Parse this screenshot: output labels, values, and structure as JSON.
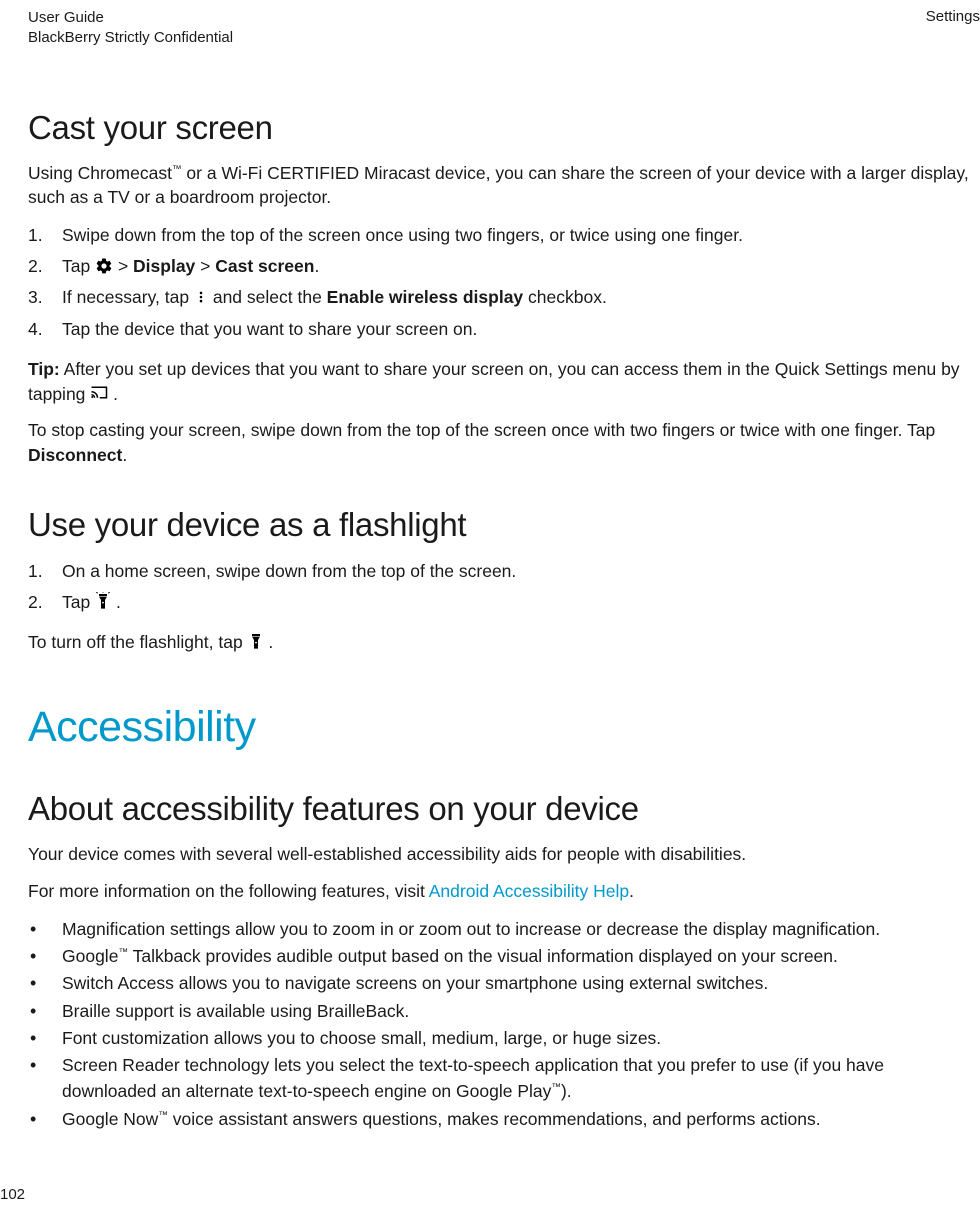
{
  "header": {
    "line1": "User Guide",
    "line2": "BlackBerry Strictly Confidential",
    "right": "Settings"
  },
  "cast": {
    "heading": "Cast your screen",
    "intro_pre": "Using Chromecast",
    "intro_post": " or a Wi-Fi CERTIFIED Miracast device, you can share the screen of your device with a larger display, such as a TV or a boardroom projector.",
    "steps": {
      "s1": "Swipe down from the top of the screen once using two fingers, or twice using one finger.",
      "s2_pre": "Tap ",
      "s2_mid1": " > ",
      "s2_bold1": "Display",
      "s2_mid2": " > ",
      "s2_bold2": "Cast screen",
      "s2_end": ".",
      "s3_pre": "If necessary, tap ",
      "s3_mid": " and select the ",
      "s3_bold": "Enable wireless display",
      "s3_end": " checkbox.",
      "s4": "Tap the device that you want to share your screen on."
    },
    "tip_label": "Tip:",
    "tip_pre": " After you set up devices that you want to share your screen on, you can access them in the Quick Settings menu by tapping ",
    "tip_end": " .",
    "stop_pre": "To stop casting your screen, swipe down from the top of the screen once with two fingers or twice with one finger. Tap ",
    "stop_bold": "Disconnect",
    "stop_end": "."
  },
  "flashlight": {
    "heading": "Use your device as a flashlight",
    "steps": {
      "s1": "On a home screen, swipe down from the top of the screen.",
      "s2_pre": "Tap ",
      "s2_end": " ."
    },
    "off_pre": "To turn off the flashlight, tap ",
    "off_end": " ."
  },
  "accessibility": {
    "major": "Accessibility",
    "heading": "About accessibility features on your device",
    "p1": "Your device comes with several well-established accessibility aids for people with disabilities.",
    "p2_pre": "For more information on the following features, visit ",
    "p2_link": "Android Accessibility Help",
    "p2_end": ".",
    "bullets": {
      "b1": "Magnification settings allow you to zoom in or zoom out to increase or decrease the display magnification.",
      "b2_pre": "Google",
      "b2_post": " Talkback provides audible output based on the visual information displayed on your screen.",
      "b3": "Switch Access allows you to navigate screens on your smartphone using external switches.",
      "b4": "Braille support is available using BrailleBack.",
      "b5": "Font customization allows you to choose small, medium, large, or huge sizes.",
      "b6_pre": "Screen Reader technology lets you select the text-to-speech application that you prefer to use (if you have downloaded an alternate text-to-speech engine on Google Play",
      "b6_post": ").",
      "b7_pre": "Google Now",
      "b7_post": " voice assistant answers questions, makes recommendations, and performs actions."
    }
  },
  "page_number": "102",
  "tm": "™"
}
